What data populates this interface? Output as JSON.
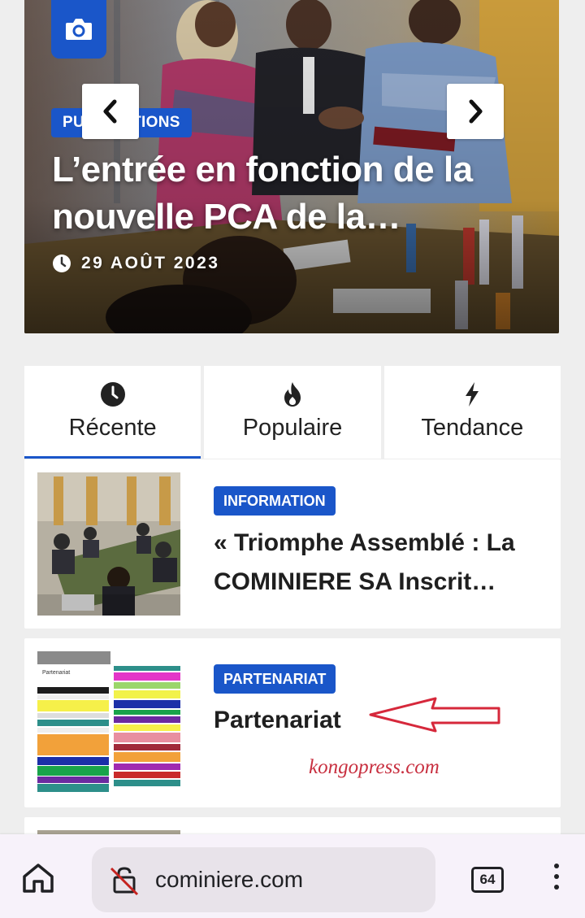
{
  "hero": {
    "category": "PUBLICATIONS",
    "title": "L’entrée en fonction de la nouvelle PCA de la…",
    "date": "29 AOÛT 2023",
    "icons": {
      "badge": "camera-icon",
      "prev": "chevron-left-icon",
      "next": "chevron-right-icon",
      "date": "clock-icon"
    }
  },
  "tabs": [
    {
      "label": "Récente",
      "icon": "clock-icon",
      "active": true
    },
    {
      "label": "Populaire",
      "icon": "fire-icon",
      "active": false
    },
    {
      "label": "Tendance",
      "icon": "bolt-icon",
      "active": false
    }
  ],
  "posts": [
    {
      "category": "INFORMATION",
      "title": "« Triomphe Assemblé : La COMINIERE SA Inscrit…"
    },
    {
      "category": "PARTENARIAT",
      "title": "Partenariat",
      "watermark": "kongopress.com",
      "thumb_heading": "Partenariat"
    }
  ],
  "browser": {
    "url": "cominiere.com",
    "tab_count": "64",
    "icons": {
      "home": "home-icon",
      "security": "not-secure-lock-icon",
      "menu": "more-vert-icon"
    }
  },
  "colors": {
    "accent": "#1a56c9",
    "annotation": "#d6283b"
  }
}
